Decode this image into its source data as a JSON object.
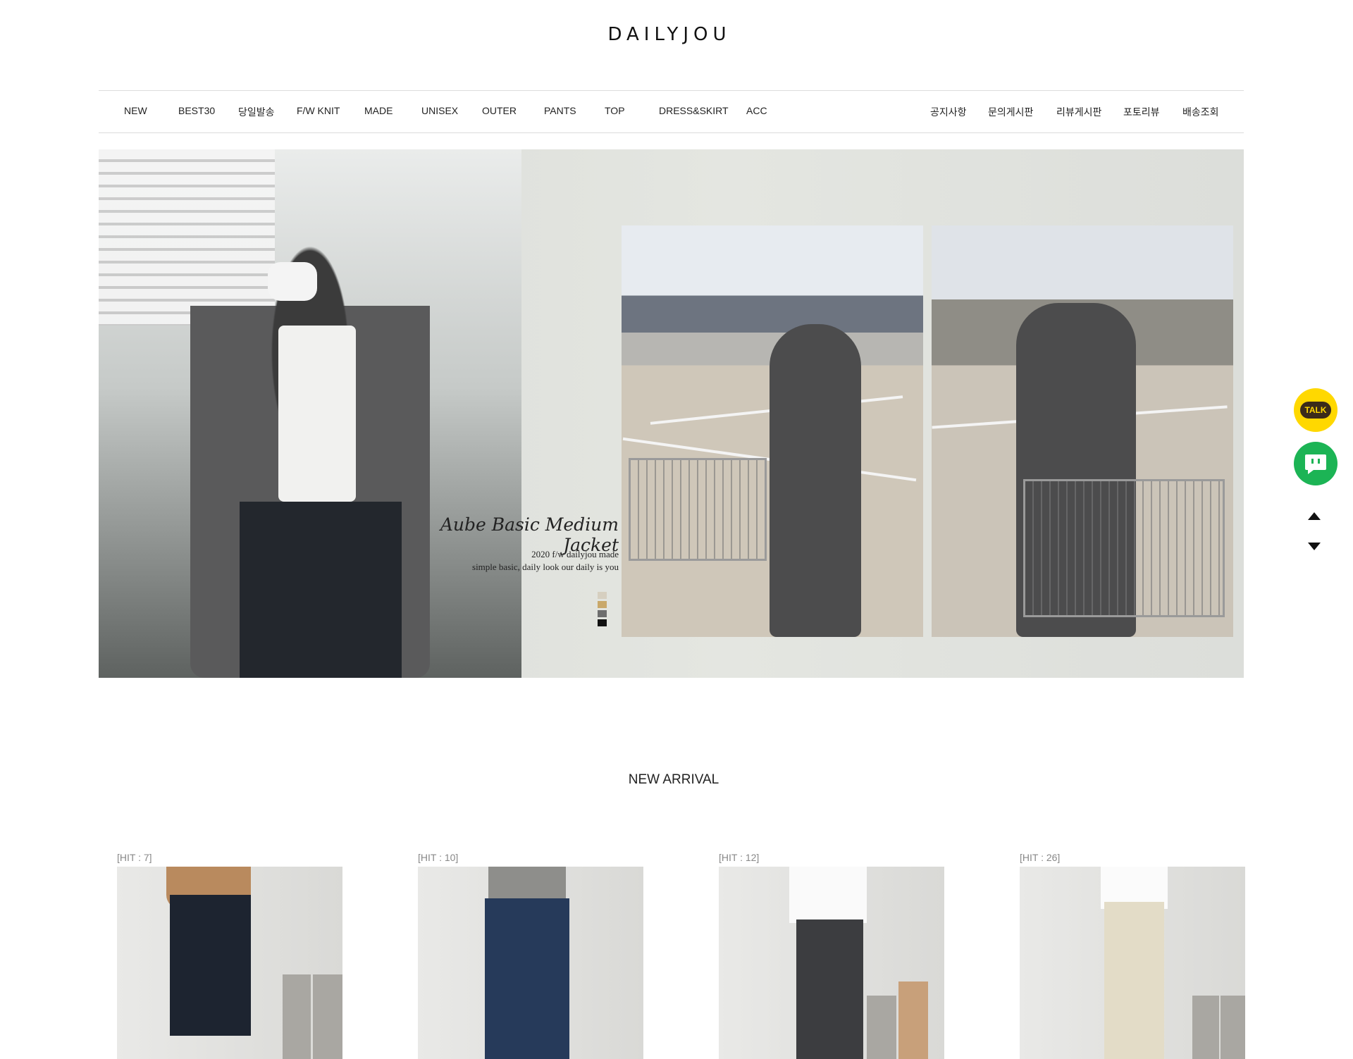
{
  "header": {
    "logo": "DAILYJOU"
  },
  "nav": {
    "left": [
      "NEW",
      "BEST30",
      "당일발송",
      "F/W KNIT",
      "MADE",
      "UNISEX",
      "OUTER",
      "PANTS",
      "TOP",
      "DRESS&SKIRT",
      "ACC"
    ],
    "right": [
      "공지사항",
      "문의게시판",
      "리뷰게시판",
      "포토리뷰",
      "배송조회"
    ]
  },
  "hero": {
    "title": "Aube Basic Medium Jacket",
    "subtitle_line1": "2020 f/w dailyjou made",
    "subtitle_line2": "simple basic, daily look our daily is you",
    "swatch_colors": [
      "#d6cfc0",
      "#c9a86a",
      "#6e6e6e",
      "#111111"
    ]
  },
  "section": {
    "title": "NEW ARRIVAL"
  },
  "products": [
    {
      "hit": "[HIT : 7]"
    },
    {
      "hit": "[HIT : 10]"
    },
    {
      "hit": "[HIT : 12]"
    },
    {
      "hit": "[HIT : 26]"
    }
  ],
  "floating": {
    "talk_label": "TALK"
  },
  "colors": {
    "kakao": "#ffd800",
    "chat": "#1cb455"
  }
}
